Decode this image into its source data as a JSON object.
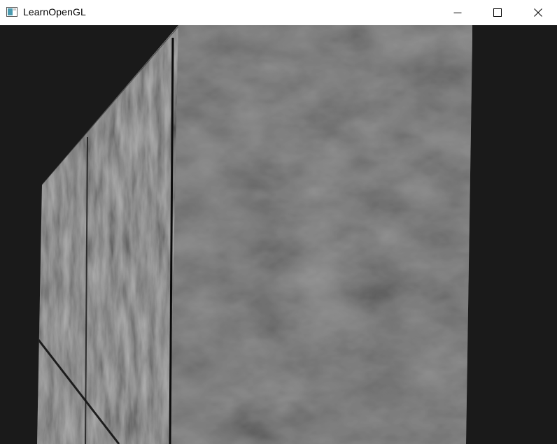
{
  "window": {
    "title": "LearnOpenGL",
    "icon": "opengl-window-icon",
    "controls": [
      "minimize-icon",
      "maximize-icon",
      "close-icon"
    ]
  },
  "viewport": {
    "clear_color": "#1a1a1a",
    "content": "rendered-textured-cubes"
  }
}
